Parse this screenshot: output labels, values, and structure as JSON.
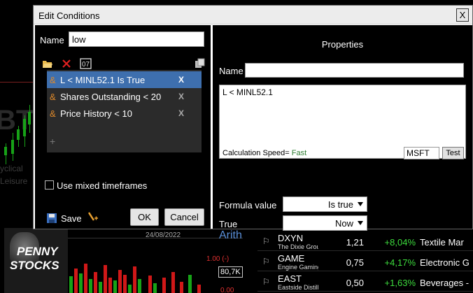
{
  "dialog": {
    "title": "Edit Conditions",
    "close_label": "X",
    "name_label": "Name",
    "name_value": "low",
    "conditions": [
      {
        "op": "&",
        "text": "L < MINL52.1 Is True",
        "remove": "X",
        "selected": true
      },
      {
        "op": "&",
        "text": "Shares Outstanding < 20",
        "remove": "X",
        "selected": false
      },
      {
        "op": "&",
        "text": "Price History < 10",
        "remove": "X",
        "selected": false
      }
    ],
    "add_label": "+",
    "mixed_timeframes_label": "Use mixed timeframes",
    "save_label": "Save",
    "ok_label": "OK",
    "cancel_label": "Cancel"
  },
  "properties": {
    "title": "Properties",
    "name_label": "Name",
    "name_value": "",
    "formula_text": "L < MINL52.1",
    "calc_speed_label": "Calculation Speed=",
    "calc_speed_value": "Fast",
    "symbol_value": "MSFT",
    "test_label": "Test",
    "formula_value_label": "Formula value",
    "formula_value_selected": "Is true",
    "true_label": "True",
    "true_selected": "Now"
  },
  "background": {
    "left_ghost_text": "BTN",
    "left_ghost_line2": "yclical",
    "left_ghost_line3": "Leisure",
    "promo_line1": "PENNY",
    "promo_line2": "STOCKS",
    "chart_date": "24/08/2022",
    "price_tag": "80,7K",
    "price_red1": "1.00 (-)",
    "price_red2": "0.00",
    "arith_label": "Arith",
    "quotes": [
      {
        "ticker": "DXYN",
        "name": "The Dixie Grou",
        "price": "1,21",
        "change": "+8,04%",
        "industry": "Textile Mar"
      },
      {
        "ticker": "GAME",
        "name": "Engine Gaming",
        "price": "0,75",
        "change": "+4,17%",
        "industry": "Electronic G"
      },
      {
        "ticker": "EAST",
        "name": "Eastside Distilli",
        "price": "0,50",
        "change": "+1,63%",
        "industry": "Beverages -"
      }
    ]
  },
  "colors": {
    "selected_row": "#3e6fae",
    "amp": "#e08a2a",
    "fast": "#2e7d32",
    "positive": "#3ddc3d"
  },
  "icons": [
    "folder-open-icon",
    "delete-icon",
    "formula-icon",
    "copy-icon",
    "save-icon",
    "wand-icon",
    "flag-icon"
  ]
}
